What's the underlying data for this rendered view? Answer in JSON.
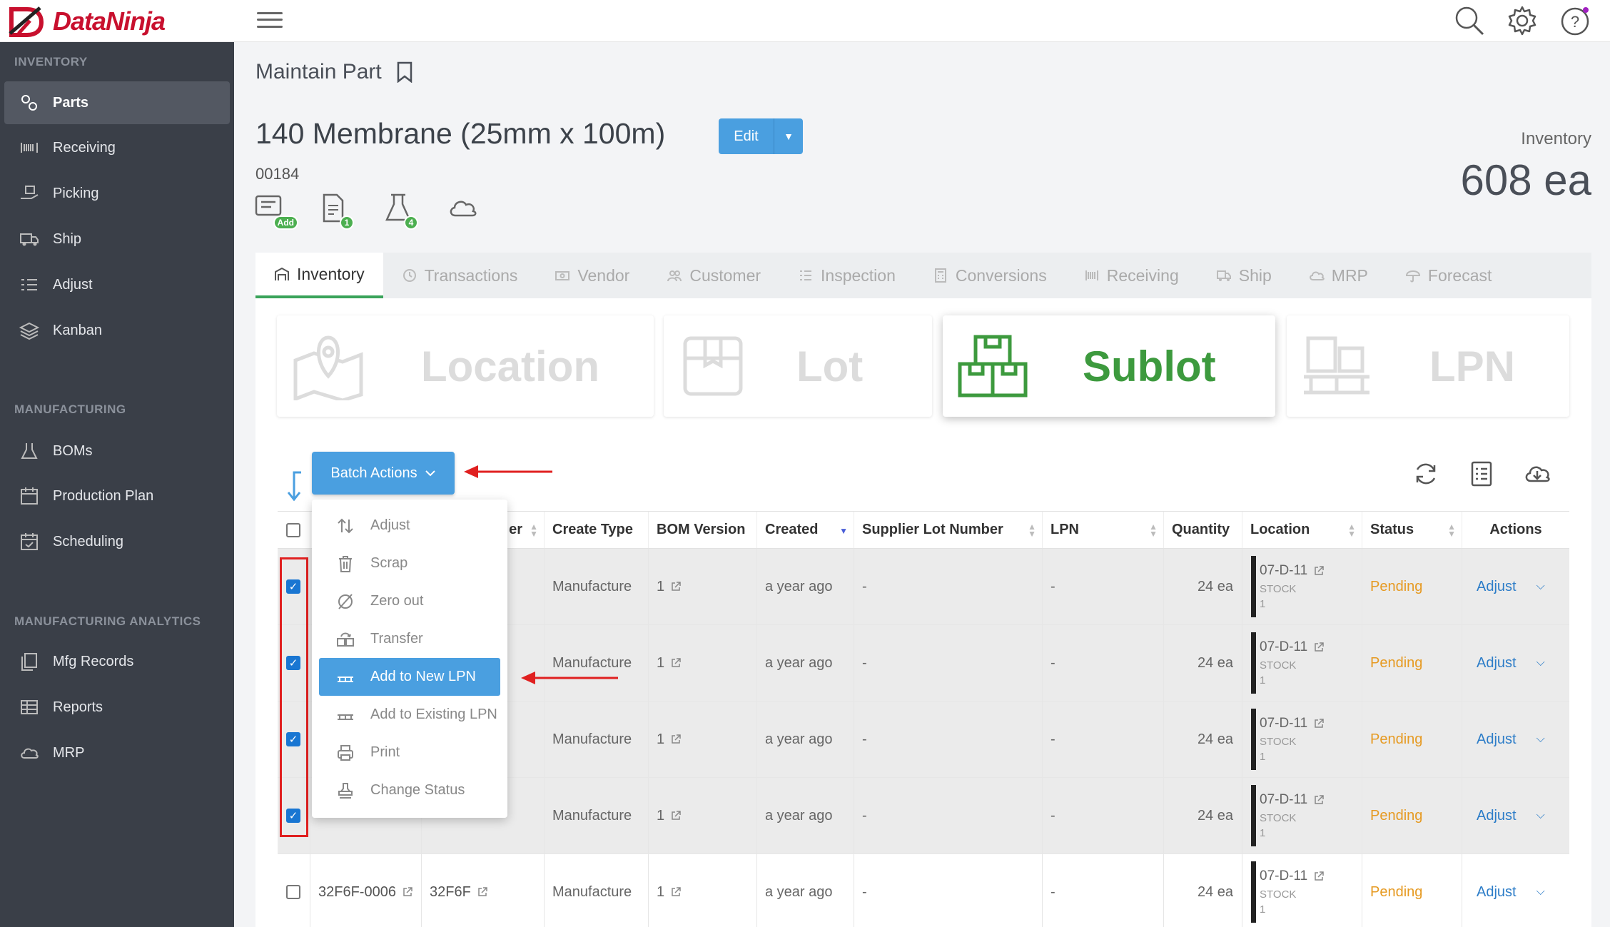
{
  "app": {
    "brand": "DataNinja",
    "brand_color": "#c8102e"
  },
  "sidebar": {
    "sections": [
      {
        "label": "INVENTORY"
      },
      {
        "label": "MANUFACTURING"
      },
      {
        "label": "MANUFACTURING ANALYTICS"
      }
    ],
    "items": [
      {
        "label": "Parts",
        "icon": "gears-icon"
      },
      {
        "label": "Receiving",
        "icon": "barcode-icon"
      },
      {
        "label": "Picking",
        "icon": "hand-box-icon"
      },
      {
        "label": "Ship",
        "icon": "truck-icon"
      },
      {
        "label": "Adjust",
        "icon": "list-icon"
      },
      {
        "label": "Kanban",
        "icon": "layers-icon"
      },
      {
        "label": "BOMs",
        "icon": "flask-icon"
      },
      {
        "label": "Production Plan",
        "icon": "calendar-icon"
      },
      {
        "label": "Scheduling",
        "icon": "calendar-check-icon"
      },
      {
        "label": "Mfg Records",
        "icon": "copy-icon"
      },
      {
        "label": "Reports",
        "icon": "table-icon"
      },
      {
        "label": "MRP",
        "icon": "cloud-icon"
      }
    ]
  },
  "page": {
    "title": "Maintain Part",
    "part_name": "140 Membrane (25mm x 100m)",
    "edit_label": "Edit",
    "part_number": "00184",
    "badges": {
      "notes": "Add",
      "docs": "1",
      "tests": "4"
    },
    "inventory_label": "Inventory",
    "inventory_value": "608 ea"
  },
  "tabs": [
    {
      "label": "Inventory"
    },
    {
      "label": "Transactions"
    },
    {
      "label": "Vendor"
    },
    {
      "label": "Customer"
    },
    {
      "label": "Inspection"
    },
    {
      "label": "Conversions"
    },
    {
      "label": "Receiving"
    },
    {
      "label": "Ship"
    },
    {
      "label": "MRP"
    },
    {
      "label": "Forecast"
    }
  ],
  "views": [
    {
      "label": "Location"
    },
    {
      "label": "Lot"
    },
    {
      "label": "Sublot"
    },
    {
      "label": "LPN"
    }
  ],
  "batch_actions_label": "Batch Actions",
  "batch_menu": [
    {
      "label": "Adjust"
    },
    {
      "label": "Scrap"
    },
    {
      "label": "Zero out"
    },
    {
      "label": "Transfer"
    },
    {
      "label": "Add to New LPN"
    },
    {
      "label": "Add to Existing LPN"
    },
    {
      "label": "Print"
    },
    {
      "label": "Change Status"
    }
  ],
  "table": {
    "columns": [
      "",
      "",
      "er",
      "Create Type",
      "BOM Version",
      "Created",
      "Supplier Lot Number",
      "LPN",
      "Quantity",
      "Location",
      "Status",
      "Actions"
    ],
    "rows": [
      {
        "sublot": "",
        "lot": "",
        "create_type": "Manufacture",
        "bom": "1",
        "created": "a year ago",
        "supplier_lot": "-",
        "lpn": "-",
        "qty": "24 ea",
        "loc": "07-D-11",
        "loc_type": "STOCK",
        "loc_num": "1",
        "status": "Pending",
        "action": "Adjust"
      },
      {
        "sublot": "",
        "lot": "",
        "create_type": "Manufacture",
        "bom": "1",
        "created": "a year ago",
        "supplier_lot": "-",
        "lpn": "-",
        "qty": "24 ea",
        "loc": "07-D-11",
        "loc_type": "STOCK",
        "loc_num": "1",
        "status": "Pending",
        "action": "Adjust"
      },
      {
        "sublot": "",
        "lot": "",
        "create_type": "Manufacture",
        "bom": "1",
        "created": "a year ago",
        "supplier_lot": "-",
        "lpn": "-",
        "qty": "24 ea",
        "loc": "07-D-11",
        "loc_type": "STOCK",
        "loc_num": "1",
        "status": "Pending",
        "action": "Adjust"
      },
      {
        "sublot": "",
        "lot": "",
        "create_type": "Manufacture",
        "bom": "1",
        "created": "a year ago",
        "supplier_lot": "-",
        "lpn": "-",
        "qty": "24 ea",
        "loc": "07-D-11",
        "loc_type": "STOCK",
        "loc_num": "1",
        "status": "Pending",
        "action": "Adjust"
      },
      {
        "sublot": "32F6F-0006",
        "lot": "32F6F",
        "create_type": "Manufacture",
        "bom": "1",
        "created": "a year ago",
        "supplier_lot": "-",
        "lpn": "-",
        "qty": "24 ea",
        "loc": "07-D-11",
        "loc_type": "STOCK",
        "loc_num": "1",
        "status": "Pending",
        "action": "Adjust"
      }
    ]
  }
}
